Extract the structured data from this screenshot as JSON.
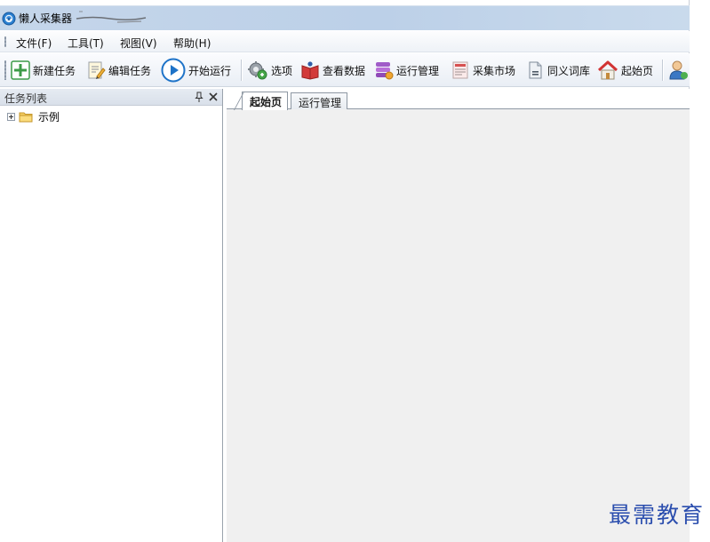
{
  "window": {
    "title": "懒人采集器"
  },
  "menu": {
    "items": [
      {
        "label": "文件(F)"
      },
      {
        "label": "工具(T)"
      },
      {
        "label": "视图(V)"
      },
      {
        "label": "帮助(H)"
      }
    ]
  },
  "toolbar": {
    "buttons": [
      {
        "label": "新建任务",
        "icon": "new-task-icon"
      },
      {
        "label": "编辑任务",
        "icon": "edit-task-icon"
      },
      {
        "label": "开始运行",
        "icon": "play-icon"
      },
      {
        "label": "选项",
        "icon": "gear-icon"
      },
      {
        "label": "查看数据",
        "icon": "view-data-icon"
      },
      {
        "label": "运行管理",
        "icon": "database-icon"
      },
      {
        "label": "采集市场",
        "icon": "market-icon"
      },
      {
        "label": "同义词库",
        "icon": "document-icon"
      },
      {
        "label": "起始页",
        "icon": "home-icon"
      }
    ],
    "extra_icon": "user-icon"
  },
  "task_panel": {
    "title": "任务列表",
    "tree": [
      {
        "label": "示例",
        "expanded": false
      }
    ]
  },
  "tabs": [
    {
      "label": "起始页",
      "active": true
    },
    {
      "label": "运行管理",
      "active": false
    }
  ],
  "watermark": {
    "text": "最需教育"
  },
  "colors": {
    "accent_blue": "#1e73c8",
    "watermark_blue": "#2b4eae"
  }
}
